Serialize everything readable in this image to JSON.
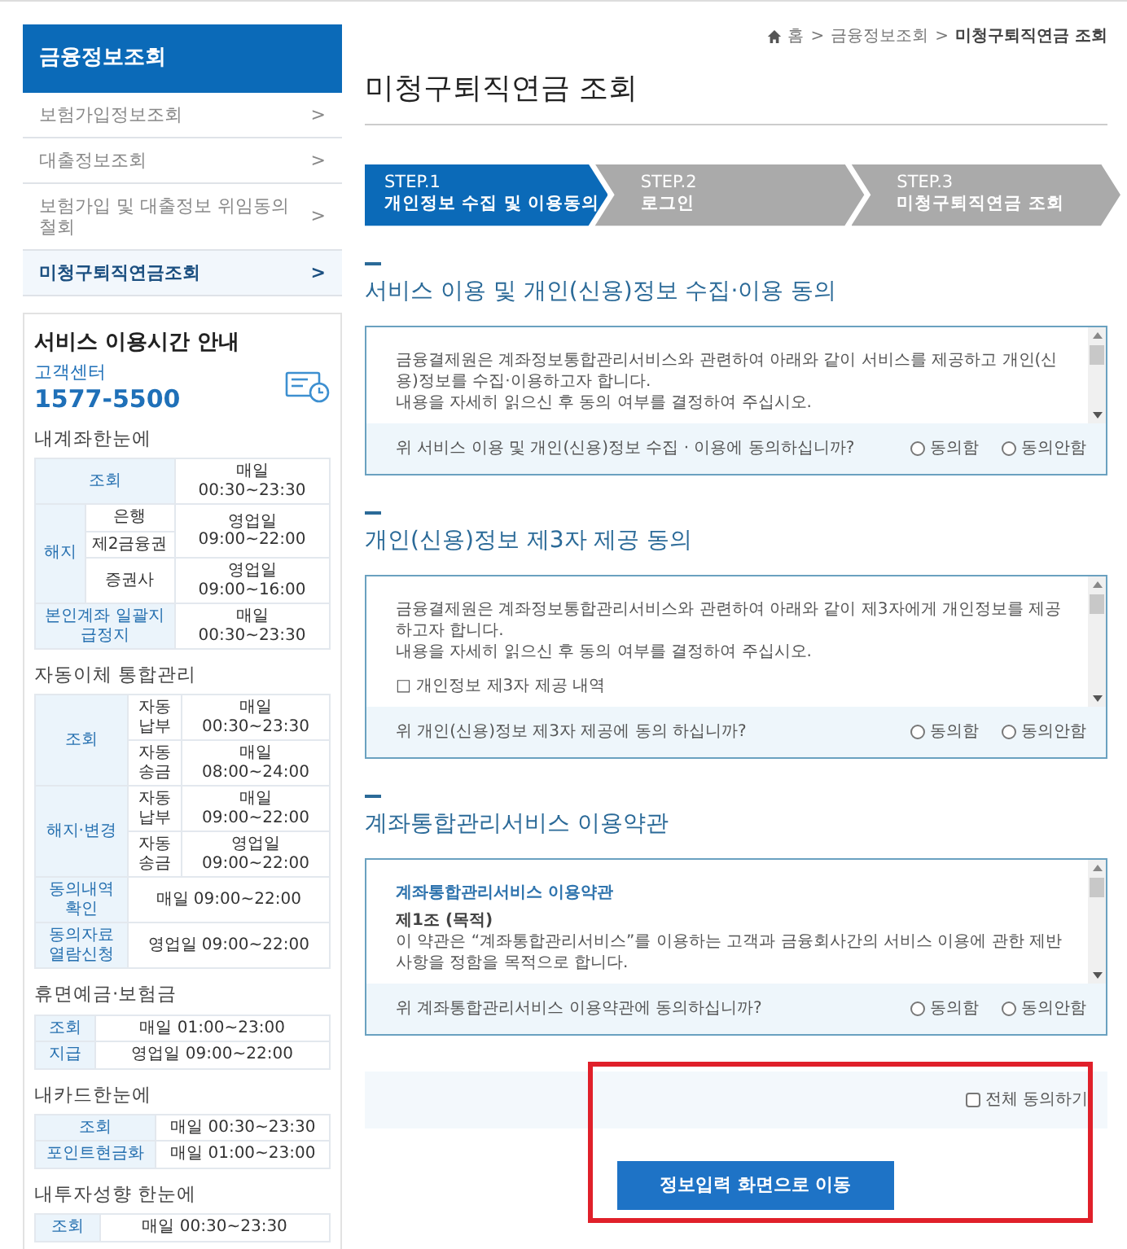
{
  "sidebar": {
    "title": "금융정보조회",
    "menu": [
      {
        "label": "보험가입정보조회",
        "arrow": ">",
        "selected": false
      },
      {
        "label": "대출정보조회",
        "arrow": ">",
        "selected": false
      },
      {
        "label": "보험가입 및 대출정보 위임동의 철회",
        "arrow": ">",
        "selected": false
      },
      {
        "label": "미청구퇴직연금조회",
        "arrow": ">",
        "selected": true
      }
    ],
    "service": {
      "title": "서비스 이용시간 안내",
      "center_label": "고객센터",
      "phone": "1577-5500",
      "sections": [
        {
          "title": "내계좌한눈에",
          "groups": [
            {
              "kind": "wide_label",
              "label": "조회",
              "time": "매일 00:30~23:30"
            },
            {
              "kind": "split",
              "label": "해지",
              "entries": [
                {
                  "labels": [
                    "은행",
                    "제2금융권"
                  ],
                  "time": "영업일 09:00~22:00"
                },
                {
                  "labels": [
                    "증권사"
                  ],
                  "time": "영업일 09:00~16:00"
                }
              ]
            },
            {
              "kind": "wide_label",
              "label": "본인계좌 일괄지급정지",
              "time": "매일 00:30~23:30"
            }
          ]
        },
        {
          "title": "자동이체 통합관리",
          "groups": [
            {
              "kind": "split",
              "label": "조회",
              "entries": [
                {
                  "labels": [
                    "자동납부"
                  ],
                  "time": "매일 00:30~23:30"
                },
                {
                  "labels": [
                    "자동송금"
                  ],
                  "time": "매일 08:00~24:00"
                }
              ]
            },
            {
              "kind": "split",
              "label": "해지·변경",
              "entries": [
                {
                  "labels": [
                    "자동납부"
                  ],
                  "time": "매일 09:00~22:00"
                },
                {
                  "labels": [
                    "자동송금"
                  ],
                  "time": "영업일 09:00~22:00"
                }
              ]
            },
            {
              "kind": "wide_time",
              "label": "동의내역 확인",
              "time": "매일 09:00~22:00"
            },
            {
              "kind": "wide_time",
              "label": "동의자료 열람신청",
              "time": "영업일 09:00~22:00"
            }
          ]
        },
        {
          "title": "휴면예금·보험금",
          "groups": [
            {
              "kind": "plain",
              "label": "조회",
              "time": "매일 01:00~23:00"
            },
            {
              "kind": "plain",
              "label": "지급",
              "time": "영업일 09:00~22:00"
            }
          ]
        },
        {
          "title": "내카드한눈에",
          "groups": [
            {
              "kind": "plain",
              "label": "조회",
              "time": "매일 00:30~23:30"
            },
            {
              "kind": "plain",
              "label": "포인트현금화",
              "time": "매일 01:00~23:00"
            }
          ]
        },
        {
          "title": "내투자성향 한눈에",
          "groups": [
            {
              "kind": "plain",
              "label": "조회",
              "time": "매일 00:30~23:30"
            }
          ]
        }
      ]
    }
  },
  "breadcrumb": [
    {
      "kind": "home",
      "text": "홈"
    },
    {
      "kind": "sep",
      "text": ">"
    },
    {
      "kind": "link",
      "text": "금융정보조회"
    },
    {
      "kind": "sep",
      "text": ">"
    },
    {
      "kind": "current",
      "text": "미청구퇴직연금 조회"
    }
  ],
  "title": "미청구퇴직연금 조회",
  "steps": [
    {
      "number": "STEP.1",
      "label": "개인정보 수집 및 이용동의",
      "selected": true
    },
    {
      "number": "STEP.2",
      "label": "로그인",
      "selected": false
    },
    {
      "number": "STEP.3",
      "label": "미청구퇴직연금 조회",
      "selected": false
    }
  ],
  "sections": [
    {
      "title": "서비스 이용 및 개인(신용)정보 수집·이용 동의",
      "content": [
        {
          "kind": "text",
          "text": "금융결제원은 계좌정보통합관리서비스와 관련하여 아래와 같이 서비스를 제공하고 개인(신용)정보를 수집·이용하고자 합니다."
        },
        {
          "kind": "text",
          "text": "내용을 자세히 읽으신 후 동의 여부를 결정하여 주십시오."
        }
      ],
      "question": "위 서비스 이용 및 개인(신용)정보 수집 · 이용에 동의하십니까?",
      "options": [
        {
          "label": "동의함",
          "selected": false
        },
        {
          "label": "동의안함",
          "selected": false
        }
      ]
    },
    {
      "title": "개인(신용)정보 제3자 제공 동의",
      "content": [
        {
          "kind": "text",
          "text": "금융결제원은 계좌정보통합관리서비스와 관련하여 아래와 같이 제3자에게 개인정보를 제공하고자 합니다."
        },
        {
          "kind": "text",
          "text": "내용을 자세히 읽으신 후 동의 여부를 결정하여 주십시오."
        },
        {
          "kind": "item",
          "text": "□ 개인정보 제3자 제공 내역"
        }
      ],
      "question": "위 개인(신용)정보 제3자 제공에 동의 하십니까?",
      "options": [
        {
          "label": "동의함",
          "selected": false
        },
        {
          "label": "동의안함",
          "selected": false
        }
      ]
    },
    {
      "title": "계좌통합관리서비스 이용약관",
      "content": [
        {
          "kind": "title",
          "text": "계좌통합관리서비스 이용약관"
        },
        {
          "kind": "heading",
          "text": "제1조 (목적)"
        },
        {
          "kind": "text",
          "text": "이 약관은 “계좌통합관리서비스”를 이용하는 고객과 금융회사간의 서비스 이용에 관한 제반 사항을 정함을 목적으로 합니다."
        }
      ],
      "question": "위 계좌통합관리서비스 이용약관에 동의하십니까?",
      "options": [
        {
          "label": "동의함",
          "selected": false
        },
        {
          "label": "동의안함",
          "selected": false
        }
      ]
    }
  ],
  "agree_all": {
    "label": "전체 동의하기",
    "checked": false
  },
  "submit": "정보입력 화면으로 이동",
  "highlight": true
}
